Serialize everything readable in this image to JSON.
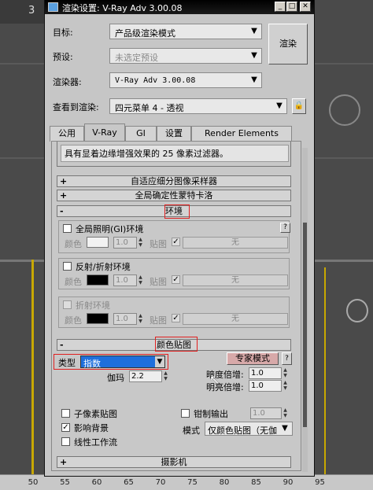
{
  "background": {
    "corner_text": "3",
    "ruler_ticks": [
      "50",
      "55",
      "60",
      "65",
      "70",
      "75",
      "80",
      "85",
      "90",
      "95"
    ]
  },
  "dialog": {
    "title": "渲染设置: V-Ray Adv 3.00.08",
    "target_label": "目标:",
    "target_value": "产品级渲染模式",
    "preset_label": "预设:",
    "preset_value": "未选定预设",
    "renderer_label": "渲染器:",
    "renderer_value": "V-Ray Adv 3.00.08",
    "view_label": "查看到渲染:",
    "view_value": "四元菜单 4 - 透视",
    "render_button": "渲染",
    "tabs": [
      "公用",
      "V-Ray",
      "GI",
      "设置",
      "Render Elements"
    ],
    "active_tab": "V-Ray"
  },
  "panel": {
    "top_text": "具有显着边缘增强效果的 25 像素过滤器。",
    "rollouts": {
      "adaptive": {
        "sign": "+",
        "label": "自适应细分图像采样器"
      },
      "global_dmc": {
        "sign": "+",
        "label": "全局确定性蒙特卡洛"
      },
      "environment": {
        "sign": "-",
        "label": "环境"
      },
      "color_mapping": {
        "sign": "-",
        "label": "颜色贴图"
      },
      "camera": {
        "sign": "+",
        "label": "摄影机"
      }
    },
    "env": {
      "gi_label": "全局照明(GI)环境",
      "help": "?",
      "color_label": "颜色",
      "multiplier": "1.0",
      "map_label": "贴图",
      "none_label": "无",
      "refl_label": "反射/折射环境",
      "refr_label": "折射环境",
      "gi_swatch": "#f2f2f2",
      "refl_swatch": "#000000",
      "refr_swatch": "#000000"
    },
    "cmap": {
      "type_label": "类型",
      "type_value": "指数",
      "expert_button": "专家模式",
      "help": "?",
      "gamma_label": "伽玛",
      "gamma_value": "2.2",
      "dark_label": "暗度倍增:",
      "dark_value": "1.0",
      "bright_label": "明亮倍增:",
      "bright_value": "1.0",
      "subpixel_label": "子像素贴图",
      "clamp_label": "钳制输出",
      "clamp_value": "1.0",
      "affect_bg_label": "影响背景",
      "affect_bg_check": "✓",
      "mode_label": "模式",
      "mode_value": "仅颜色贴图（无伽",
      "linear_label": "线性工作流"
    }
  },
  "colors": {
    "highlight_red": "#e02020",
    "dropdown_selected": "#1e6fdc",
    "expert_button": "#d7a9a9"
  }
}
